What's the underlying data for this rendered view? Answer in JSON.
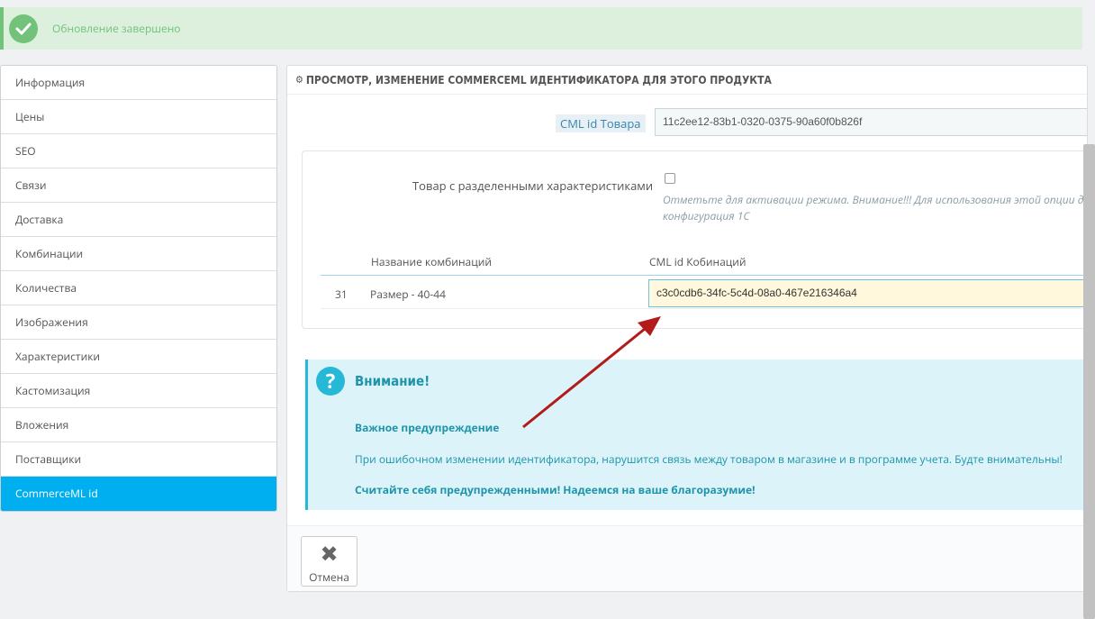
{
  "alert": {
    "message": "Обновление завершено"
  },
  "sidebar": {
    "items": [
      {
        "label": "Информация"
      },
      {
        "label": "Цены"
      },
      {
        "label": "SEO"
      },
      {
        "label": "Связи"
      },
      {
        "label": "Доставка"
      },
      {
        "label": "Комбинации"
      },
      {
        "label": "Количества"
      },
      {
        "label": "Изображения"
      },
      {
        "label": "Характеристики"
      },
      {
        "label": "Кастомизация"
      },
      {
        "label": "Вложения"
      },
      {
        "label": "Поставщики"
      },
      {
        "label": "CommerceML id"
      }
    ],
    "active_index": 12
  },
  "panel": {
    "title": "ПРОСМОТР, ИЗМЕНЕНИЕ COMMERCEML ИДЕНТИФИКАТОРА ДЛЯ ЭТОГО ПРОДУКТА",
    "cml_label": "CML id Товара",
    "cml_value": "11c2ee12-83b1-0320-0375-90a60f0b826f",
    "split_label": "Товар с разделенными характеристиками",
    "split_checked": false,
    "help_text": "Отметьте для активации режима. Внимание!!! Для использования этой опции д конфигурация 1С",
    "table": {
      "headers": [
        "Название комбинаций",
        "CML id Кобинаций"
      ],
      "rows": [
        {
          "id": "31",
          "name": "Размер - 40-44",
          "cml": "c3c0cdb6-34fc-5c4d-08a0-467e216346a4"
        }
      ]
    }
  },
  "warning": {
    "title": "Внимание!",
    "subtitle": "Важное предупреждение",
    "text": "При ошибочном изменении идентификатора, нарушится связь между товаром в магазине и в программе учета. Будте внимательны!",
    "final": "Считайте себя предупрежденными! Надеемся на ваше благоразумие!"
  },
  "footer": {
    "cancel_label": "Отмена"
  },
  "colors": {
    "accent": "#00aff0",
    "success": "#72c279",
    "info": "#25b9d7",
    "arrow": "#b31b1b"
  }
}
